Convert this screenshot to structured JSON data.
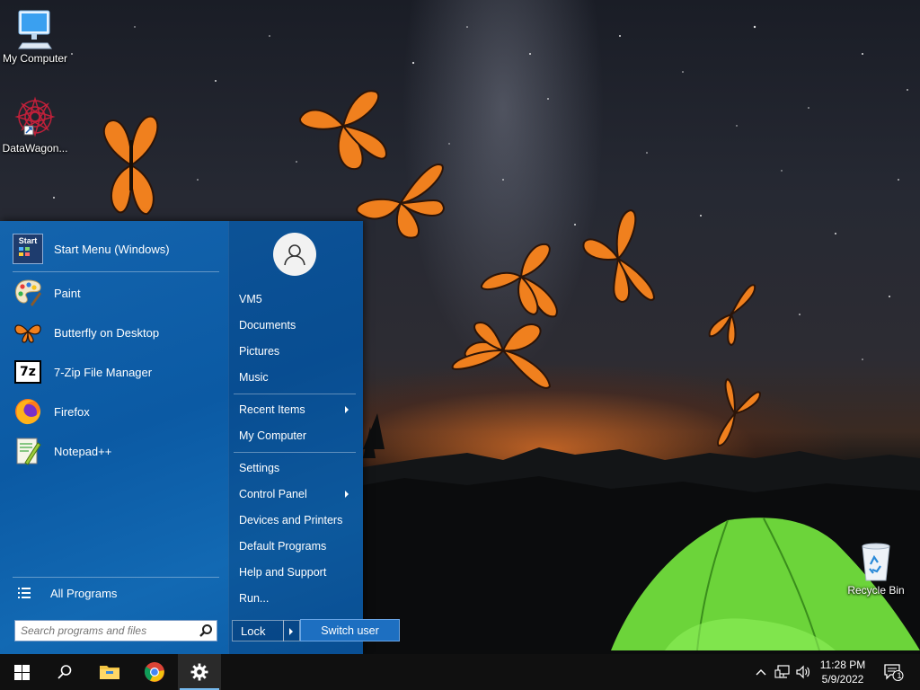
{
  "desktop": {
    "icons": [
      {
        "label": "My Computer",
        "icon": "monitor-icon"
      },
      {
        "label": "DataWagon...",
        "icon": "mandala-shortcut-icon"
      },
      {
        "label": "Recycle Bin",
        "icon": "recycle-bin-icon"
      }
    ]
  },
  "start_menu": {
    "pinned": [
      {
        "label": "Start Menu (Windows)",
        "icon": "start-menu-app-icon"
      },
      {
        "label": "Paint",
        "icon": "paint-palette-icon"
      },
      {
        "label": "Butterfly on Desktop",
        "icon": "butterfly-icon"
      },
      {
        "label": "7-Zip File Manager",
        "icon": "7zip-icon",
        "icon_text": "7z"
      },
      {
        "label": "Firefox",
        "icon": "firefox-icon"
      },
      {
        "label": "Notepad++",
        "icon": "notepadpp-icon"
      }
    ],
    "start_icon_text": "Start",
    "all_programs": "All Programs",
    "search_placeholder": "Search programs and files",
    "right": {
      "user": "VM5",
      "documents": "Documents",
      "pictures": "Pictures",
      "music": "Music",
      "recent_items": "Recent Items",
      "my_computer": "My Computer",
      "settings": "Settings",
      "control_panel": "Control Panel",
      "devices_printers": "Devices and Printers",
      "default_programs": "Default Programs",
      "help_support": "Help and Support",
      "run": "Run..."
    },
    "lock": "Lock",
    "switch_user": "Switch user"
  },
  "taskbar": {
    "time": "11:28 PM",
    "date": "5/9/2022",
    "notification_count": "1",
    "pinned": [
      "windows-logo-icon",
      "search-icon",
      "file-explorer-icon",
      "chrome-icon",
      "gear-icon"
    ]
  },
  "colors": {
    "start_menu_bg": "#0b5aa4",
    "taskbar_bg": "#101010",
    "accent": "#76b9ed",
    "switch_user_bg": "#1d6fc1"
  }
}
